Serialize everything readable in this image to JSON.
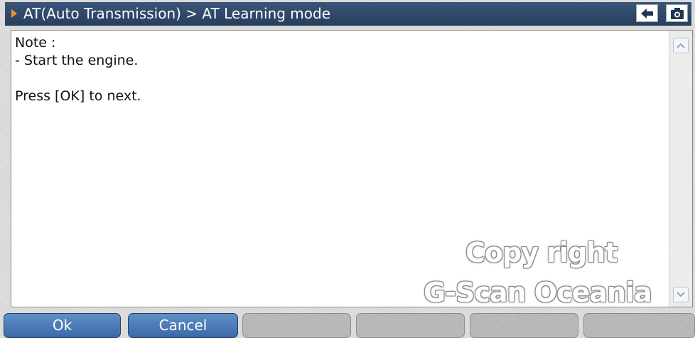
{
  "header": {
    "breadcrumb": "AT(Auto Transmission) > AT Learning mode",
    "back_icon": "arrow-left-icon",
    "camera_icon": "camera-icon"
  },
  "content": {
    "message": "Note :\n- Start the engine.\n\nPress [OK] to next."
  },
  "watermark": {
    "line1": "Copy right",
    "line2": "G-Scan Oceania"
  },
  "footer": {
    "buttons": [
      "Ok",
      "Cancel",
      "",
      "",
      "",
      ""
    ]
  },
  "colors": {
    "title_bar": "#2e4a6e",
    "accent_arrow": "#f0912e",
    "active_button": "#4a7ab8"
  }
}
